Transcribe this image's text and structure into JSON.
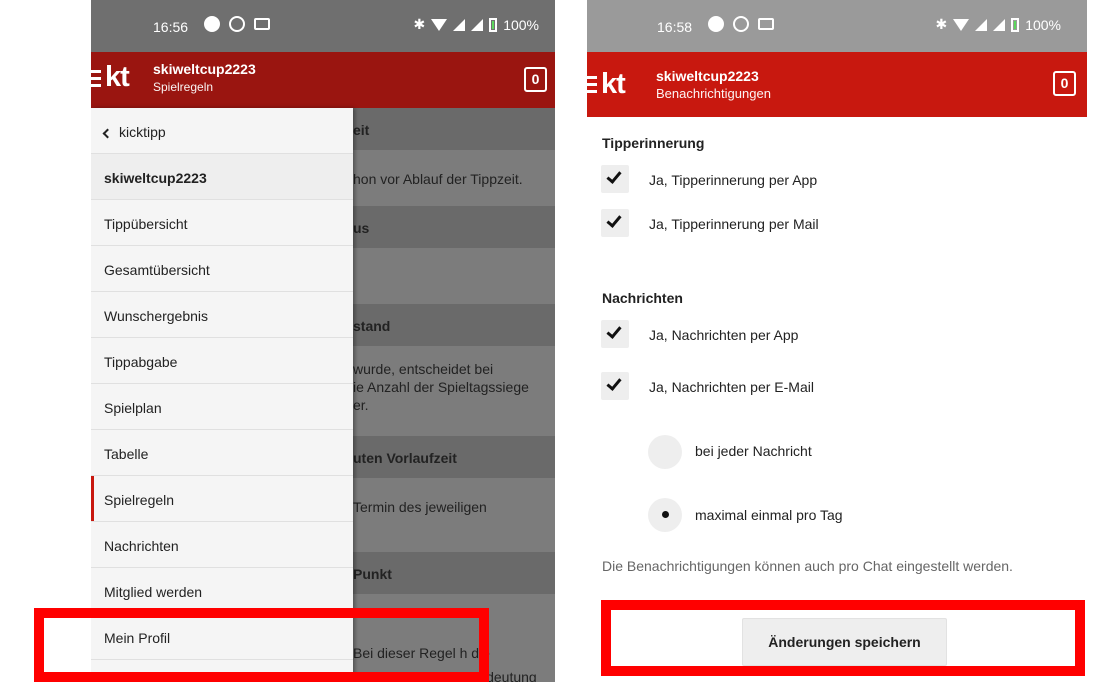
{
  "left": {
    "status": {
      "time": "16:56",
      "battery": "100%"
    },
    "appbar": {
      "logo": "kt",
      "title": "skiweltcup2223",
      "subtitle": "Spielregeln",
      "counter": "0"
    },
    "drawer": {
      "back_label": "kicktipp",
      "items": [
        {
          "label": "skiweltcup2223"
        },
        {
          "label": "Tippübersicht"
        },
        {
          "label": "Gesamtübersicht"
        },
        {
          "label": "Wunschergebnis"
        },
        {
          "label": "Tippabgabe"
        },
        {
          "label": "Spielplan"
        },
        {
          "label": "Tabelle"
        },
        {
          "label": "Spielregeln"
        },
        {
          "label": "Nachrichten"
        },
        {
          "label": "Mitglied werden"
        },
        {
          "label": "Mein Profil"
        }
      ]
    },
    "underlying": {
      "h1": "eit",
      "t1": "hon vor Ablauf der Tippzeit.",
      "h2": "us",
      "h3": "stand",
      "t3a": "wurde, entscheidet bei",
      "t3b": "ie Anzahl der Spieltagssiege",
      "t3c": "er.",
      "h4": "uten Vorlaufzeit",
      "t4": "Termin des jeweiligen",
      "h5": "Punkt",
      "t5": "Bei dieser Regel h   die",
      "t6": "Reihenfolge keine Bedeutung"
    }
  },
  "right": {
    "status": {
      "time": "16:58",
      "battery": "100%"
    },
    "appbar": {
      "logo": "kt",
      "title": "skiweltcup2223",
      "subtitle": "Benachrichtigungen",
      "counter": "0"
    },
    "tipperinnerung": {
      "title": "Tipperinnerung",
      "app": "Ja, Tipperinnerung per App",
      "mail": "Ja, Tipperinnerung per Mail"
    },
    "nachrichten": {
      "title": "Nachrichten",
      "app": "Ja, Nachrichten per App",
      "mail": "Ja, Nachrichten per E-Mail",
      "opt1": "bei jeder Nachricht",
      "opt2": "maximal einmal pro Tag"
    },
    "info": "Die Benachrichtigungen können auch pro Chat eingestellt werden.",
    "save_label": "Änderungen speichern"
  },
  "colors": {
    "brand_red": "#c8180f",
    "highlight": "#ff0000"
  }
}
